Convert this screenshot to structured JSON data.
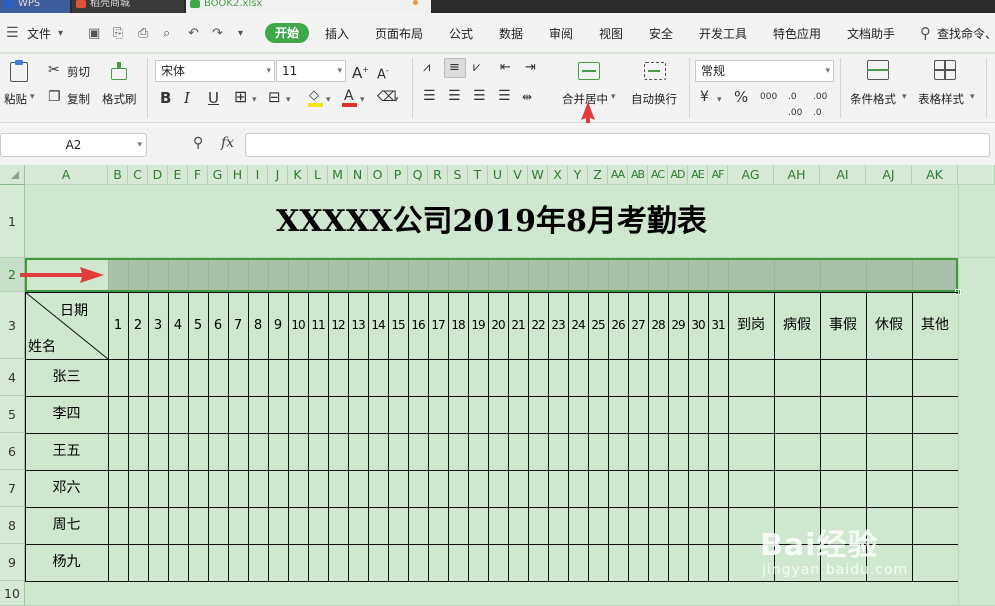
{
  "window": {
    "tabs": [
      {
        "label": "WPS"
      },
      {
        "label": "稻壳商城"
      },
      {
        "label": "BOOK2.xlsx"
      }
    ]
  },
  "menu": {
    "file": "文件",
    "active": "开始",
    "items": [
      "插入",
      "页面布局",
      "公式",
      "数据",
      "审阅",
      "视图",
      "安全",
      "开发工具",
      "特色应用",
      "文档助手"
    ],
    "search": "查找命令、"
  },
  "ribbon": {
    "paste": "粘贴",
    "cut": "剪切",
    "copy": "复制",
    "format_painter": "格式刷",
    "font_name": "宋体",
    "font_size": "11",
    "merge_center": "合并居中",
    "wrap_text": "自动换行",
    "number_format": "常规",
    "conditional_format": "条件格式",
    "table_style": "表格样式",
    "accent": "#3fa84a"
  },
  "formula": {
    "name_box": "A2",
    "fx": "fx",
    "value": ""
  },
  "sheet": {
    "columns": [
      "A",
      "B",
      "C",
      "D",
      "E",
      "F",
      "G",
      "H",
      "I",
      "J",
      "K",
      "L",
      "M",
      "N",
      "O",
      "P",
      "Q",
      "R",
      "S",
      "T",
      "U",
      "V",
      "W",
      "X",
      "Y",
      "Z",
      "AA",
      "AB",
      "AC",
      "AD",
      "AE",
      "AF",
      "AG",
      "AH",
      "AI",
      "AJ",
      "AK"
    ],
    "rows": [
      "1",
      "2",
      "3",
      "4",
      "5",
      "6",
      "7",
      "8",
      "9",
      "10"
    ],
    "title": "XXXXX公司2019年8月考勤表",
    "corner_date": "日期",
    "corner_name": "姓名",
    "days": [
      "1",
      "2",
      "3",
      "4",
      "5",
      "6",
      "7",
      "8",
      "9",
      "10",
      "11",
      "12",
      "13",
      "14",
      "15",
      "16",
      "17",
      "18",
      "19",
      "20",
      "21",
      "22",
      "23",
      "24",
      "25",
      "26",
      "27",
      "28",
      "29",
      "30",
      "31"
    ],
    "summary": [
      "到岗",
      "病假",
      "事假",
      "休假",
      "其他"
    ],
    "names": [
      "张三",
      "李四",
      "王五",
      "邓六",
      "周七",
      "杨九"
    ],
    "selection_color": "#a9c1a9",
    "arrow_color": "#e23b3b"
  },
  "watermark": {
    "brand": "Bai经验",
    "url": "jingyan.baidu.com"
  }
}
